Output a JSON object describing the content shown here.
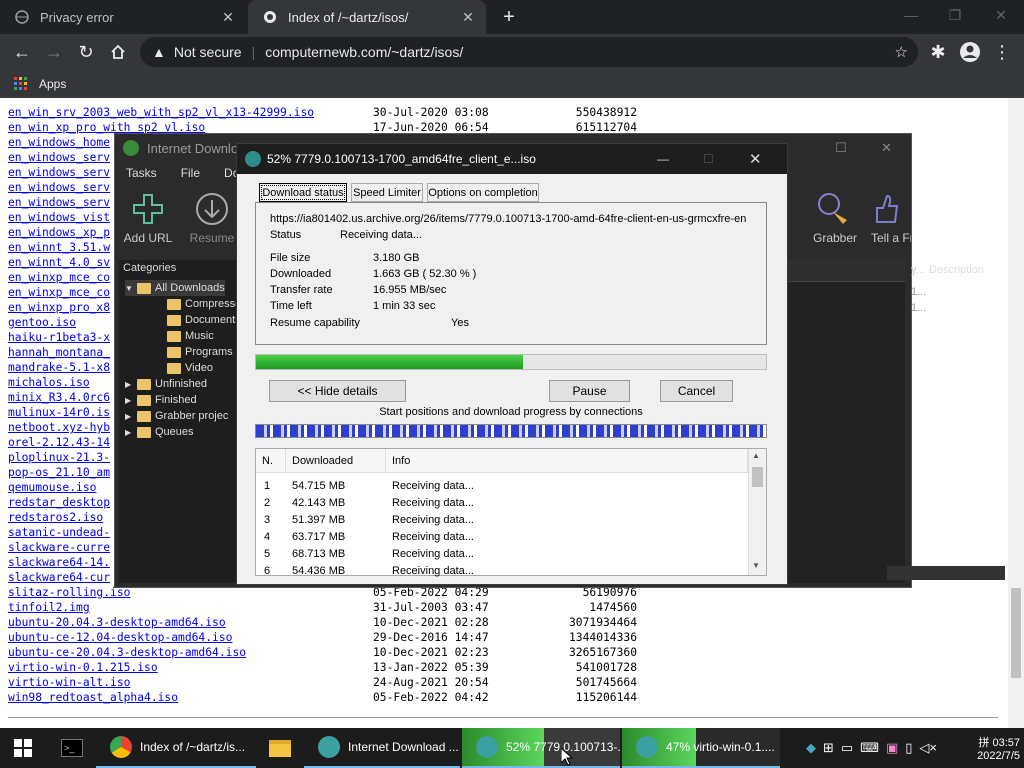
{
  "browser": {
    "tabs": [
      {
        "title": "Privacy error",
        "active": false
      },
      {
        "title": "Index of /~dartz/isos/",
        "active": true
      }
    ],
    "new_tab": "+",
    "security": "Not secure",
    "url": "computernewb.com/~dartz/isos/",
    "bookmarks_label": "Apps"
  },
  "listing": [
    {
      "name": "en_win_srv_2003_web_with_sp2_vl_x13-42999.iso",
      "date": "30-Jul-2020 03:08",
      "size": "550438912"
    },
    {
      "name": "en_win_xp_pro_with_sp2_vl.iso",
      "date": "17-Jun-2020 06:54",
      "size": "615112704"
    },
    {
      "name": "en_windows_home",
      "date": "",
      "size": ""
    },
    {
      "name": "en_windows_serv",
      "date": "",
      "size": ""
    },
    {
      "name": "en_windows_serv",
      "date": "",
      "size": ""
    },
    {
      "name": "en_windows_serv",
      "date": "",
      "size": ""
    },
    {
      "name": "en_windows_serv",
      "date": "",
      "size": ""
    },
    {
      "name": "en_windows_vist",
      "date": "",
      "size": ""
    },
    {
      "name": "en_windows_xp_p",
      "date": "",
      "size": ""
    },
    {
      "name": "en_winnt_3.51.w",
      "date": "",
      "size": ""
    },
    {
      "name": "en_winnt_4.0_sv",
      "date": "",
      "size": ""
    },
    {
      "name": "en_winxp_mce_co",
      "date": "",
      "size": ""
    },
    {
      "name": "en_winxp_mce_co",
      "date": "",
      "size": ""
    },
    {
      "name": "en_winxp_pro_x8",
      "date": "",
      "size": ""
    },
    {
      "name": "gentoo.iso",
      "date": "",
      "size": ""
    },
    {
      "name": "haiku-r1beta3-x",
      "date": "",
      "size": ""
    },
    {
      "name": "hannah_montana_",
      "date": "",
      "size": ""
    },
    {
      "name": "mandrake-5.1-x8",
      "date": "",
      "size": ""
    },
    {
      "name": "michalos.iso",
      "date": "",
      "size": ""
    },
    {
      "name": "minix_R3.4.0rc6",
      "date": "",
      "size": ""
    },
    {
      "name": "mulinux-14r0.is",
      "date": "",
      "size": ""
    },
    {
      "name": "netboot.xyz-hyb",
      "date": "",
      "size": ""
    },
    {
      "name": "orel-2.12.43-14",
      "date": "",
      "size": ""
    },
    {
      "name": "ploplinux-21.3-",
      "date": "",
      "size": ""
    },
    {
      "name": "pop-os_21.10_am",
      "date": "",
      "size": ""
    },
    {
      "name": "qemumouse.iso",
      "date": "",
      "size": ""
    },
    {
      "name": "redstar_desktop",
      "date": "",
      "size": ""
    },
    {
      "name": "redstaros2.iso",
      "date": "",
      "size": ""
    },
    {
      "name": "satanic-undead-",
      "date": "",
      "size": ""
    },
    {
      "name": "slackware-curre",
      "date": "",
      "size": ""
    },
    {
      "name": "slackware64-14.",
      "date": "",
      "size": ""
    },
    {
      "name": "slackware64-cur",
      "date": "",
      "size": ""
    },
    {
      "name": "slitaz-rolling.iso",
      "date": "05-Feb-2022 04:29",
      "size": "56190976"
    },
    {
      "name": "tinfoil2.img",
      "date": "31-Jul-2003 03:47",
      "size": "1474560"
    },
    {
      "name": "ubuntu-20.04.3-desktop-amd64.iso",
      "date": "10-Dec-2021 02:28",
      "size": "3071934464"
    },
    {
      "name": "ubuntu-ce-12.04-desktop-amd64.iso",
      "date": "29-Dec-2016 14:47",
      "size": "1344014336"
    },
    {
      "name": "ubuntu-ce-20.04.3-desktop-amd64.iso",
      "date": "10-Dec-2021 02:23",
      "size": "3265167360"
    },
    {
      "name": "virtio-win-0.1.215.iso",
      "date": "13-Jan-2022 05:39",
      "size": "541001728"
    },
    {
      "name": "virtio-win-alt.iso",
      "date": "24-Aug-2021 20:54",
      "size": "501745664"
    },
    {
      "name": "win98_redtoast_alpha4.iso",
      "date": "05-Feb-2022 04:42",
      "size": "115206144"
    }
  ],
  "idm": {
    "title": "Internet Download",
    "menu": [
      "Tasks",
      "File",
      "Dov"
    ],
    "tools": {
      "add_url": "Add URL",
      "resume": "Resume",
      "grabber": "Grabber",
      "tell": "Tell a Fr"
    },
    "categories_header": "Categories",
    "categories": [
      {
        "label": "All Downloads",
        "indent": 0
      },
      {
        "label": "Compresse",
        "indent": 1
      },
      {
        "label": "Documents",
        "indent": 1
      },
      {
        "label": "Music",
        "indent": 1
      },
      {
        "label": "Programs",
        "indent": 1
      },
      {
        "label": "Video",
        "indent": 1
      },
      {
        "label": "Unfinished",
        "indent": 0
      },
      {
        "label": "Finished",
        "indent": 0
      },
      {
        "label": "Grabber projec",
        "indent": 0
      },
      {
        "label": "Queues",
        "indent": 0
      }
    ],
    "list_col_partial": "y...",
    "list_col_description": "Description",
    "list_cells": [
      "1...",
      "1..."
    ]
  },
  "dialog": {
    "title": "52% 7779.0.100713-1700_amd64fre_client_e...iso",
    "tabs": [
      "Download status",
      "Speed Limiter",
      "Options on completion"
    ],
    "url": "https://ia801402.us.archive.org/26/items/7779.0.100713-1700-amd-64fre-client-en-us-grmcxfre-en",
    "status_label": "Status",
    "status_value": "Receiving data...",
    "file_size_label": "File size",
    "file_size_value": "3.180  GB",
    "downloaded_label": "Downloaded",
    "downloaded_value": "1.663  GB  ( 52.30 % )",
    "rate_label": "Transfer rate",
    "rate_value": "16.955  MB/sec",
    "time_label": "Time left",
    "time_value": "1 min 33 sec",
    "resume_label": "Resume capability",
    "resume_value": "Yes",
    "progress": 0.523,
    "hide_details": "<< Hide details",
    "pause": "Pause",
    "cancel": "Cancel",
    "connections_caption": "Start positions and download progress by connections",
    "table_headers": [
      "N.",
      "Downloaded",
      "Info"
    ],
    "connections": [
      {
        "n": "1",
        "downloaded": "54.715  MB",
        "info": "Receiving data..."
      },
      {
        "n": "2",
        "downloaded": "42.143  MB",
        "info": "Receiving data..."
      },
      {
        "n": "3",
        "downloaded": "51.397  MB",
        "info": "Receiving data..."
      },
      {
        "n": "4",
        "downloaded": "63.717  MB",
        "info": "Receiving data..."
      },
      {
        "n": "5",
        "downloaded": "68.713  MB",
        "info": "Receiving data..."
      },
      {
        "n": "6",
        "downloaded": "54.436  MB",
        "info": "Receiving data..."
      }
    ]
  },
  "taskbar": {
    "chrome": "Index of /~dartz/is...",
    "idm": "Internet Download ...",
    "dl1": "52% 7779.0.100713-...",
    "dl2": "47% virtio-win-0.1....",
    "ime": "拼",
    "time": "03:57",
    "date": "2022/7/5",
    "dl1_progress": 0.52,
    "dl2_progress": 0.47
  },
  "colors": {
    "accent": "#76b9ed",
    "progress_green": "#1f9a1f",
    "link": "#0000ee"
  }
}
